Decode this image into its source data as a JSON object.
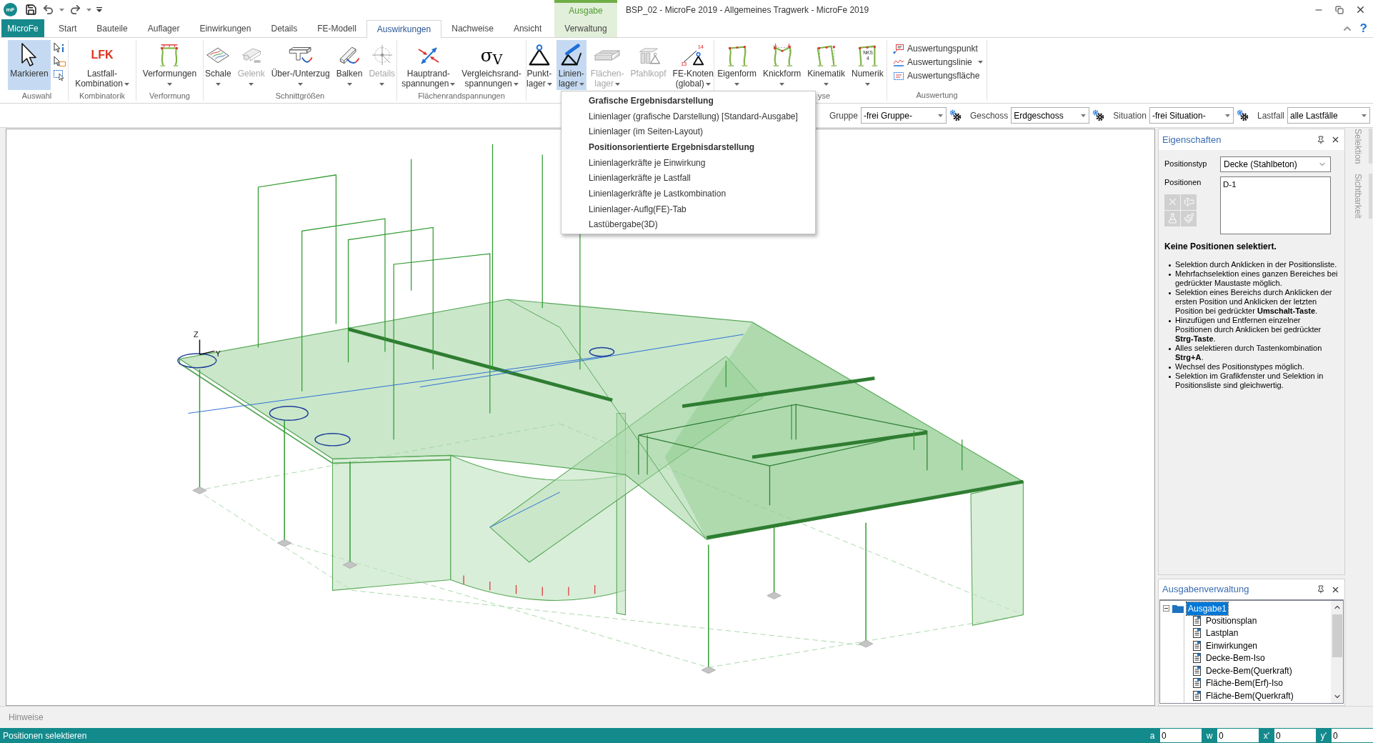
{
  "window": {
    "logo": "mF",
    "context_group": "Ausgabe",
    "title": "BSP_02 - MicroFe 2019 - Allgemeines Tragwerk - MicroFe 2019",
    "help": "?"
  },
  "ribbon_tabs": [
    {
      "label": "MicroFe",
      "kind": "file",
      "selected": false
    },
    {
      "label": "Start",
      "kind": "tab",
      "selected": false
    },
    {
      "label": "Bauteile",
      "kind": "tab",
      "selected": false
    },
    {
      "label": "Auflager",
      "kind": "tab",
      "selected": false
    },
    {
      "label": "Einwirkungen",
      "kind": "tab",
      "selected": false
    },
    {
      "label": "Details",
      "kind": "tab",
      "selected": false
    },
    {
      "label": "FE-Modell",
      "kind": "tab",
      "selected": false
    },
    {
      "label": "Auswirkungen",
      "kind": "tab",
      "selected": true
    },
    {
      "label": "Nachweise",
      "kind": "tab",
      "selected": false
    },
    {
      "label": "Ansicht",
      "kind": "tab",
      "selected": false
    },
    {
      "label": "Verwaltung",
      "kind": "context",
      "selected": false
    }
  ],
  "ribbon_groups": [
    {
      "label": "Auswahl",
      "buttons": [
        {
          "kind": "large",
          "lines": [
            "Markieren"
          ],
          "selected": true,
          "disabled": false,
          "menu": false
        }
      ]
    },
    {
      "label": "Kombinatorik",
      "buttons": [
        {
          "kind": "large",
          "symbol": "LFK",
          "lines": [
            "Lastfall-",
            "Kombination"
          ],
          "selected": false,
          "disabled": false,
          "menu": true
        }
      ]
    },
    {
      "label": "Verformung",
      "buttons": [
        {
          "kind": "large",
          "lines": [
            "Verformungen"
          ],
          "selected": false,
          "disabled": false,
          "menu": true
        }
      ]
    },
    {
      "label": "Schnittgrößen",
      "buttons": [
        {
          "kind": "large",
          "lines": [
            "Schale"
          ],
          "selected": false,
          "disabled": false,
          "menu": true
        },
        {
          "kind": "large",
          "lines": [
            "Gelenk"
          ],
          "selected": false,
          "disabled": true,
          "menu": true
        },
        {
          "kind": "large",
          "lines": [
            "Über-/Unterzug"
          ],
          "selected": false,
          "disabled": false,
          "menu": true
        },
        {
          "kind": "large",
          "lines": [
            "Balken"
          ],
          "selected": false,
          "disabled": false,
          "menu": true
        },
        {
          "kind": "large",
          "lines": [
            "Details"
          ],
          "selected": false,
          "disabled": true,
          "menu": true
        }
      ]
    },
    {
      "label": "Flächenrandspannungen",
      "buttons": [
        {
          "kind": "large",
          "lines": [
            "Hauptrand-",
            "spannungen"
          ],
          "selected": false,
          "disabled": false,
          "menu": true
        },
        {
          "kind": "large",
          "symbol": "σ$_{V}$",
          "lines": [
            "Vergleichsrand-",
            "spannungen"
          ],
          "selected": false,
          "disabled": false,
          "menu": true
        }
      ]
    },
    {
      "buttons": [
        {
          "kind": "large",
          "lines": [
            "Punkt-",
            "lager"
          ],
          "selected": false,
          "disabled": false,
          "menu": true
        },
        {
          "kind": "large",
          "lines": [
            "Linien-",
            "lager"
          ],
          "selected": true,
          "disabled": false,
          "menu": true
        },
        {
          "kind": "large",
          "lines": [
            "Flächen-",
            "lager"
          ],
          "selected": false,
          "disabled": true,
          "menu": true
        },
        {
          "kind": "large",
          "lines": [
            "Pfahlkopf"
          ],
          "selected": false,
          "disabled": true,
          "menu": false
        },
        {
          "kind": "large",
          "icon_text": [
            "14",
            "13"
          ],
          "lines": [
            "FE-Knoten",
            "(global)"
          ],
          "selected": false,
          "disabled": false,
          "menu": true
        }
      ]
    },
    {
      "label": "yse",
      "buttons": [
        {
          "kind": "large",
          "lines": [
            "Eigenform"
          ],
          "selected": false,
          "disabled": false,
          "menu": true
        },
        {
          "kind": "large",
          "lines": [
            "Knickform"
          ],
          "selected": false,
          "disabled": false,
          "menu": true
        },
        {
          "kind": "large",
          "lines": [
            "Kinematik"
          ],
          "selected": false,
          "disabled": false,
          "menu": true
        },
        {
          "kind": "large",
          "icon_text": [
            "NKS",
            "4"
          ],
          "lines": [
            "Numerik"
          ],
          "selected": false,
          "disabled": false,
          "menu": true
        }
      ]
    },
    {
      "label": "Auswertung",
      "buttons": [
        {
          "kind": "small",
          "lines": [
            "Auswertungspunkt"
          ],
          "selected": false,
          "disabled": false,
          "menu": false
        },
        {
          "kind": "small",
          "lines": [
            "Auswertungslinie"
          ],
          "selected": false,
          "disabled": false,
          "menu": true
        },
        {
          "kind": "small",
          "lines": [
            "Auswertungsfläche"
          ],
          "selected": false,
          "disabled": false,
          "menu": false
        }
      ]
    }
  ],
  "dropdown_menu": {
    "items": [
      {
        "kind": "header",
        "label": "Grafische Ergebnisdarstellung"
      },
      {
        "kind": "item",
        "label": "Linienlager (grafische Darstellung) [Standard-Ausgabe]"
      },
      {
        "kind": "item",
        "label": "Linienlager (im Seiten-Layout)"
      },
      {
        "kind": "header",
        "label": "Positionsorientierte Ergebnisdarstellung"
      },
      {
        "kind": "item",
        "label": "Linienlagerkräfte je Einwirkung"
      },
      {
        "kind": "item",
        "label": "Linienlagerkräfte je Lastfall"
      },
      {
        "kind": "item",
        "label": "Linienlagerkräfte je Lastkombination"
      },
      {
        "kind": "item",
        "label": "Linienlager-Auflg(FE)-Tab"
      },
      {
        "kind": "item",
        "label": "Lastübergabe(3D)"
      }
    ]
  },
  "filter_bar": [
    {
      "label": "Gruppe",
      "value": "-frei Gruppe-",
      "has_settings": true
    },
    {
      "label": "Geschoss",
      "value": "Erdgeschoss",
      "has_settings": true
    },
    {
      "label": "Situation",
      "value": "-frei Situation-",
      "has_settings": true
    },
    {
      "label": "Lastfall",
      "value": "alle Lastfälle",
      "has_settings": false
    }
  ],
  "canvas": {
    "axis_labels": [
      "Z",
      "Y"
    ]
  },
  "properties_panel": {
    "title": "Eigenschaften",
    "type_label": "Positionstyp",
    "type_value": "Decke (Stahlbeton)",
    "list_label": "Positionen",
    "positions": [
      "D-1"
    ],
    "tools": [
      {
        "disabled": true
      },
      {
        "disabled": true
      },
      {
        "disabled": true
      },
      {
        "disabled": true
      }
    ],
    "status": "Keine Positionen selektiert.",
    "hints": [
      "Selektion durch Anklicken in der Positionsliste.",
      "Mehrfachselektion eines ganzen Bereiches bei gedrückter Maustaste möglich.",
      "Selektion eines Bereichs durch Anklicken der ersten Position und Anklicken der letzten Position bei gedrückter **Umschalt-Taste**.",
      "Hinzufügen und Entfernen einzelner Positionen durch Anklicken bei gedrückter **Strg-Taste**.",
      "Alles selektieren durch Tastenkombination **Strg+A**.",
      "Wechsel des Positionstypes möglich.",
      "Selektion im Grafikfenster und Selektion in Positionsliste sind gleichwertig."
    ]
  },
  "side_tabs": [
    {
      "label": "Selektion"
    },
    {
      "label": "Sichtbarkeit"
    }
  ],
  "output_panel": {
    "title": "Ausgabenverwaltung",
    "tree": [
      {
        "label": "Ausgabe1",
        "expanded": true,
        "selected": true,
        "children": [
          {
            "label": "Positionsplan",
            "selected": false
          },
          {
            "label": "Lastplan",
            "selected": false
          },
          {
            "label": "Einwirkungen",
            "selected": false
          },
          {
            "label": "Decke-Bem-Iso",
            "selected": false
          },
          {
            "label": "Decke-Bem(Querkraft)",
            "selected": false
          },
          {
            "label": "Fläche-Bem(Erf)-Iso",
            "selected": false
          },
          {
            "label": "Fläche-Bem(Querkraft)",
            "selected": false
          }
        ]
      }
    ]
  },
  "hints": {
    "label": "Hinweise"
  },
  "status_bar": {
    "message": "Positionen selektieren",
    "fields": [
      {
        "label": "a",
        "value": "0"
      },
      {
        "label": "w",
        "value": "0"
      },
      {
        "label": "x'",
        "value": "0"
      },
      {
        "label": "y'",
        "value": "0"
      }
    ]
  }
}
